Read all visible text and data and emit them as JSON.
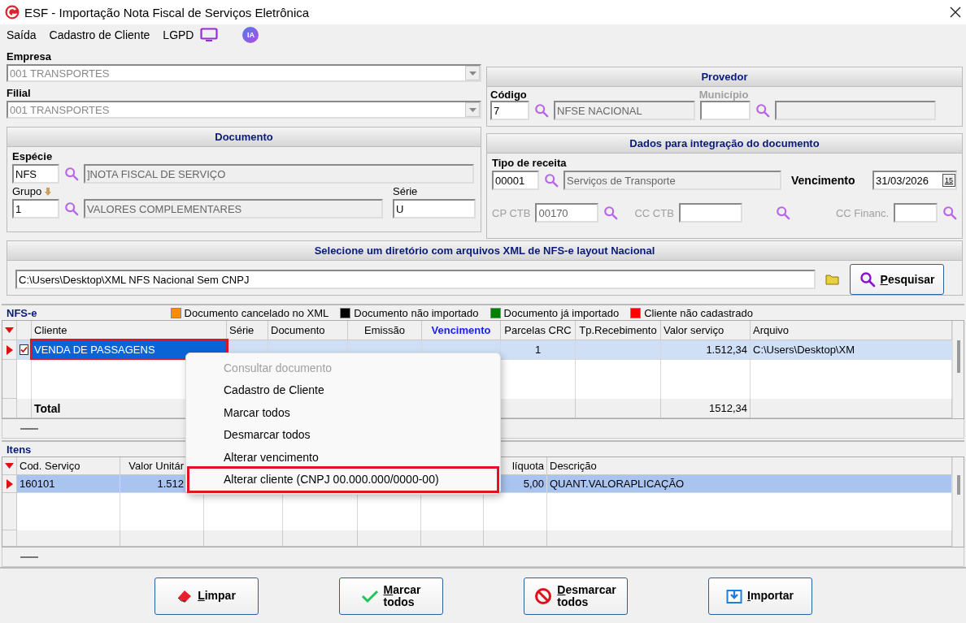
{
  "window": {
    "title": "ESF - Importação Nota Fiscal de Serviços Eletrônica"
  },
  "menu": [
    {
      "label": "Saída"
    },
    {
      "label": "Cadastro de Cliente"
    },
    {
      "label": "LGPD"
    }
  ],
  "ia_badge": "IA",
  "empresa": {
    "label": "Empresa",
    "value": "001 TRANSPORTES"
  },
  "filial": {
    "label": "Filial",
    "value": "001 TRANSPORTES"
  },
  "provedor": {
    "title": "Provedor",
    "codigo": {
      "label": "Código",
      "code": "7",
      "desc": "NFSE NACIONAL",
      "disabled": false
    },
    "municipio": {
      "label": "Município",
      "disabled": true
    }
  },
  "documento": {
    "title": "Documento",
    "especie": {
      "label": "Espécie",
      "code": "NFS",
      "desc": "]NOTA FISCAL DE SERVIÇO"
    },
    "grupo": {
      "label": "Grupo",
      "code": "1",
      "desc": "VALORES COMPLEMENTARES"
    },
    "serie": {
      "label": "Série",
      "value": "U"
    }
  },
  "dados": {
    "title": "Dados para integração do documento",
    "tipo": {
      "label": "Tipo de receita",
      "code": "00001",
      "desc": "Serviços de Transporte"
    },
    "vencimento": {
      "label": "Vencimento",
      "value": "31/03/2026",
      "calendar": "15"
    },
    "contas": [
      {
        "label": "CP CTB",
        "value": "00170",
        "disabled": true
      },
      {
        "label": "CC CTB",
        "disabled": true
      },
      {
        "label": "CC Financ.",
        "disabled": true
      }
    ]
  },
  "diretorio": {
    "title": "Selecione um diretório com arquivos XML de NFS-e layout Nacional",
    "path": "C:\\Users\\Desktop\\XML NFS Nacional Sem CNPJ",
    "button": "Pesquisar"
  },
  "nfse": {
    "title": "NFS-e",
    "legend": [
      {
        "label": "Documento cancelado no XML",
        "color": "#ff8c00"
      },
      {
        "label": "Documento não importado",
        "color": "#000000"
      },
      {
        "label": "Documento já importado",
        "color": "#008000"
      },
      {
        "label": "Cliente não cadastrado",
        "color": "#ff0000"
      }
    ],
    "columns": [
      {
        "label": "Cliente",
        "sorted": false
      },
      {
        "label": "Série",
        "sorted": false
      },
      {
        "label": "Documento",
        "sorted": false
      },
      {
        "label": "Emissão",
        "sorted": false
      },
      {
        "label": "Vencimento",
        "sorted": true
      },
      {
        "label": "Parcelas CRC",
        "sorted": false
      },
      {
        "label": "Tp.Recebimento",
        "sorted": false
      },
      {
        "label": "Valor serviço",
        "sorted": false
      },
      {
        "label": "Arquivo",
        "sorted": false
      }
    ],
    "rows": [
      {
        "selected": true,
        "checked": true,
        "highlighted": true,
        "cells": [
          "VENDA DE PASSAGENS",
          null,
          null,
          null,
          null,
          "1",
          null,
          "1.512,34",
          "C:\\Users\\Desktop\\XM"
        ]
      }
    ],
    "total": {
      "label": "Total",
      "valor": "1512,34"
    }
  },
  "itens": {
    "title": "Itens",
    "columns": [
      {
        "label": "Cod. Serviço"
      },
      {
        "label": "Valor Unitár"
      },
      {},
      {},
      {},
      {},
      {
        "label": "líquota"
      },
      {
        "label": "Descrição"
      }
    ],
    "rows": [
      {
        "selected": true,
        "cells": [
          "160101",
          "1.512",
          null,
          null,
          null,
          null,
          "5,00",
          "QUANT.VALORAPLICAÇÃO"
        ]
      }
    ]
  },
  "context_menu": [
    {
      "label": "Consultar documento",
      "disabled": true,
      "highlighted": false
    },
    {
      "label": "Cadastro de Cliente",
      "disabled": false,
      "highlighted": false
    },
    {
      "label": "Marcar todos",
      "disabled": false,
      "highlighted": false
    },
    {
      "label": "Desmarcar todos",
      "disabled": false,
      "highlighted": false
    },
    {
      "label": "Alterar vencimento",
      "disabled": false,
      "highlighted": false
    },
    {
      "label": "Alterar cliente (CNPJ 00.000.000/0000-00)",
      "disabled": false,
      "highlighted": true
    }
  ],
  "buttons": [
    {
      "label": "Limpar",
      "kind": "eraser"
    },
    {
      "label": "Marcar todos",
      "kind": "check"
    },
    {
      "label": "Desmarcar todos",
      "kind": "forbid"
    },
    {
      "label": "Importar",
      "kind": "import"
    }
  ]
}
